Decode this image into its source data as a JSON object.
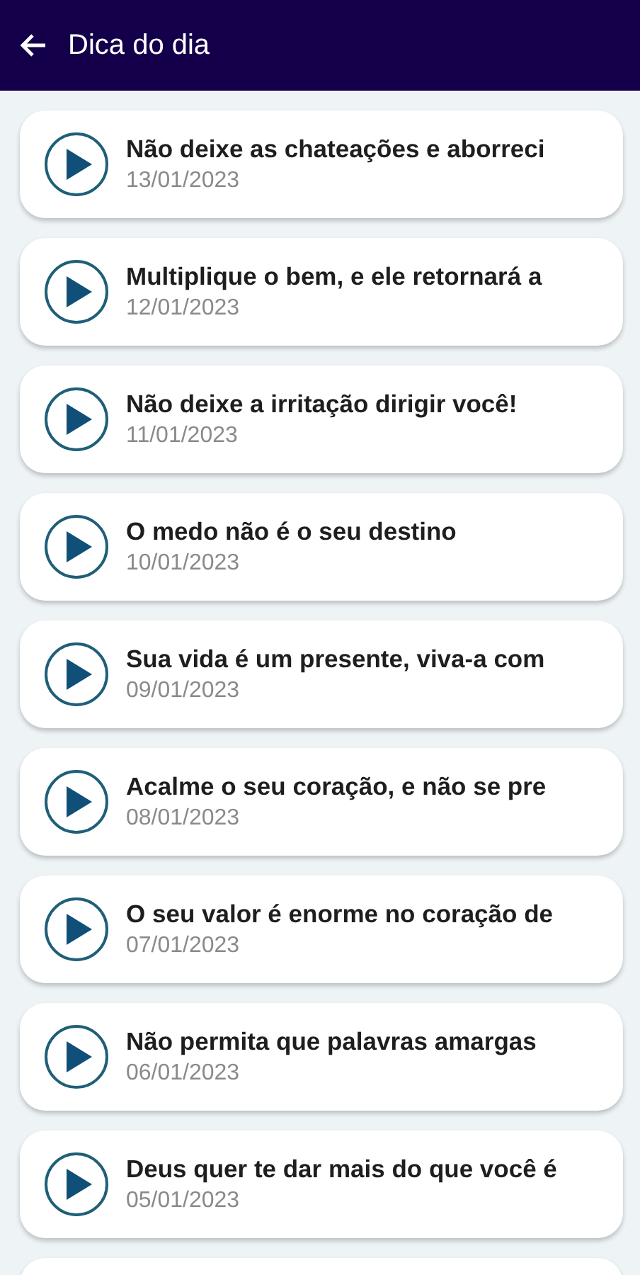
{
  "app_bar": {
    "title": "Dica do dia"
  },
  "tips": [
    {
      "kind": "tip",
      "title": "Não deixe as chateações e aborreci",
      "date": "13/01/2023"
    },
    {
      "kind": "tip",
      "title": "Multiplique o bem, e ele retornará a",
      "date": "12/01/2023"
    },
    {
      "kind": "tip",
      "title": "Não deixe a irritação dirigir você!",
      "date": "11/01/2023"
    },
    {
      "kind": "tip",
      "title": "O medo não é o seu destino",
      "date": "10/01/2023"
    },
    {
      "kind": "tip",
      "title": "Sua vida é um presente, viva-a com",
      "date": "09/01/2023"
    },
    {
      "kind": "tip",
      "title": "Acalme o seu coração, e não se pre",
      "date": "08/01/2023"
    },
    {
      "kind": "tip",
      "title": "O seu valor é enorme no coração de",
      "date": "07/01/2023"
    },
    {
      "kind": "tip",
      "title": "Não permita que palavras amargas",
      "date": "06/01/2023"
    },
    {
      "kind": "tip",
      "title": "Deus quer te dar mais do que você é",
      "date": "05/01/2023"
    },
    {
      "kind": "partial"
    }
  ]
}
